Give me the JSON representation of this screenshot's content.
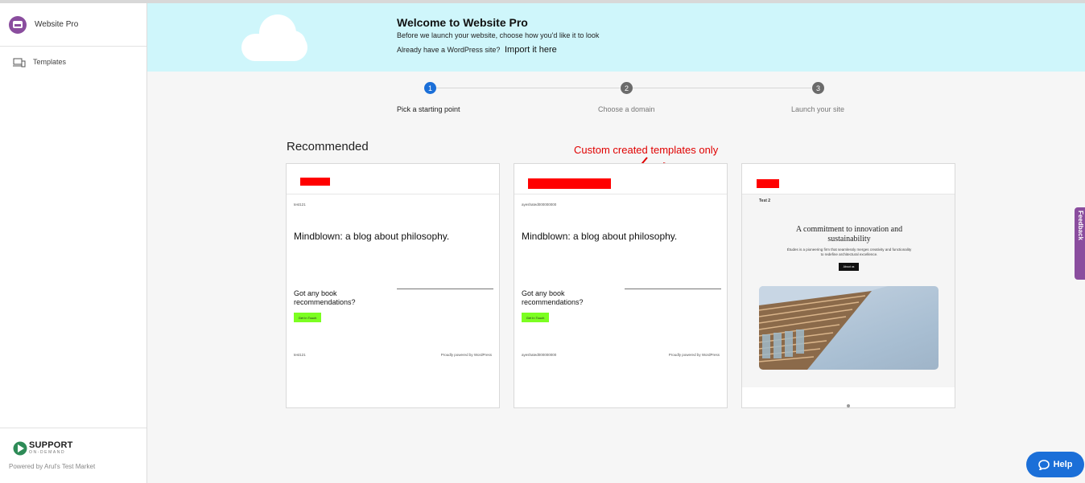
{
  "sidebar": {
    "app_title": "Website Pro",
    "items": [
      {
        "label": "Templates"
      }
    ],
    "brand_main": "SUPPORT",
    "brand_sub": "ON-DEMAND",
    "powered_by": "Powered by Arul's Test Market"
  },
  "banner": {
    "title": "Welcome to Website Pro",
    "subtitle": "Before we launch your website, choose how you'd like it to look",
    "import_question": "Already have a WordPress site?",
    "import_link": "Import it here"
  },
  "steps": [
    {
      "number": "1",
      "label": "Pick a starting point",
      "active": true
    },
    {
      "number": "2",
      "label": "Choose a domain",
      "active": false
    },
    {
      "number": "3",
      "label": "Launch your site",
      "active": false
    }
  ],
  "recommended_title": "Recommended",
  "annotation": "Custom created templates only",
  "cards": [
    {
      "site_name": "test121",
      "heading": "Mindblown: a blog about philosophy.",
      "book_prompt": "Got any book recommendations?",
      "cta": "Get In Touch",
      "footer_left": "test121",
      "footer_right": "Proudly powered by WordPress"
    },
    {
      "site_name": "ayeshated000000000",
      "heading": "Mindblown: a blog about philosophy.",
      "book_prompt": "Got any book recommendations?",
      "cta": "Get In Touch",
      "footer_left": "ayeshated000000000",
      "footer_right": "Proudly powered by WordPress"
    },
    {
      "site_name": "Test 2",
      "heading": "A commitment to innovation and sustainability",
      "description": "Études is a pioneering firm that seamlessly merges creativity and functionality to redefine architectural excellence.",
      "cta": "About us"
    }
  ],
  "feedback_label": "Feedback",
  "help_label": "Help",
  "colors": {
    "banner_bg": "#cff6fb",
    "step_active": "#1b6fd8",
    "step_inactive": "#6b6b6b",
    "annotation": "#e00000",
    "redaction": "#ff0000",
    "brand_purple": "#8a4d9e"
  }
}
